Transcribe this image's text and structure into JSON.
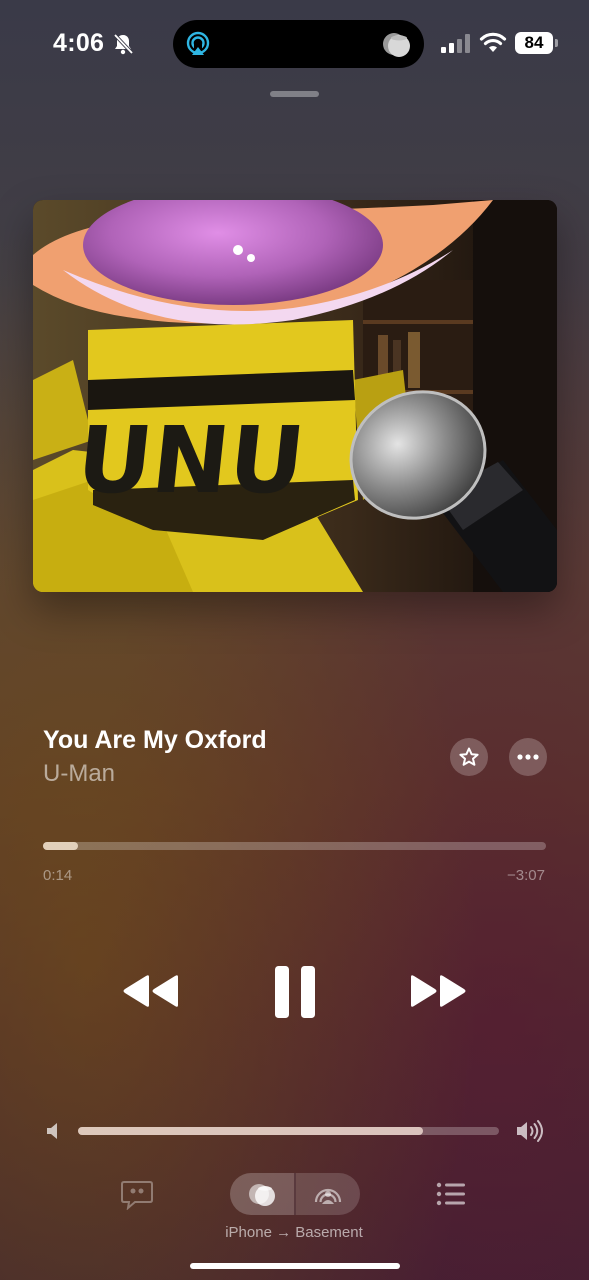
{
  "status_bar": {
    "time": "4:06",
    "battery": "84",
    "icons": [
      "bell-slash-icon",
      "airplay-icon",
      "homepod-icon",
      "cellular-signal-icon",
      "wifi-icon"
    ]
  },
  "now_playing": {
    "title": "You Are My Oxford",
    "artist": "U-Man",
    "elapsed": "0:14",
    "remaining": "−3:07",
    "progress": 0.07,
    "volume": 0.82,
    "playing": true
  },
  "actions": {
    "favorite_icon": "star-icon",
    "more_icon": "ellipsis-icon",
    "rewind_icon": "backward-icon",
    "pause_icon": "pause-icon",
    "forward_icon": "forward-icon"
  },
  "bottom_bar": {
    "lyrics_icon": "lyrics-quote-icon",
    "route_label": "iPhone → Basement",
    "queue_icon": "list-icon"
  },
  "colors": {
    "accent_airplay": "#2fb6e3",
    "text_secondary": "#b9a79c"
  }
}
